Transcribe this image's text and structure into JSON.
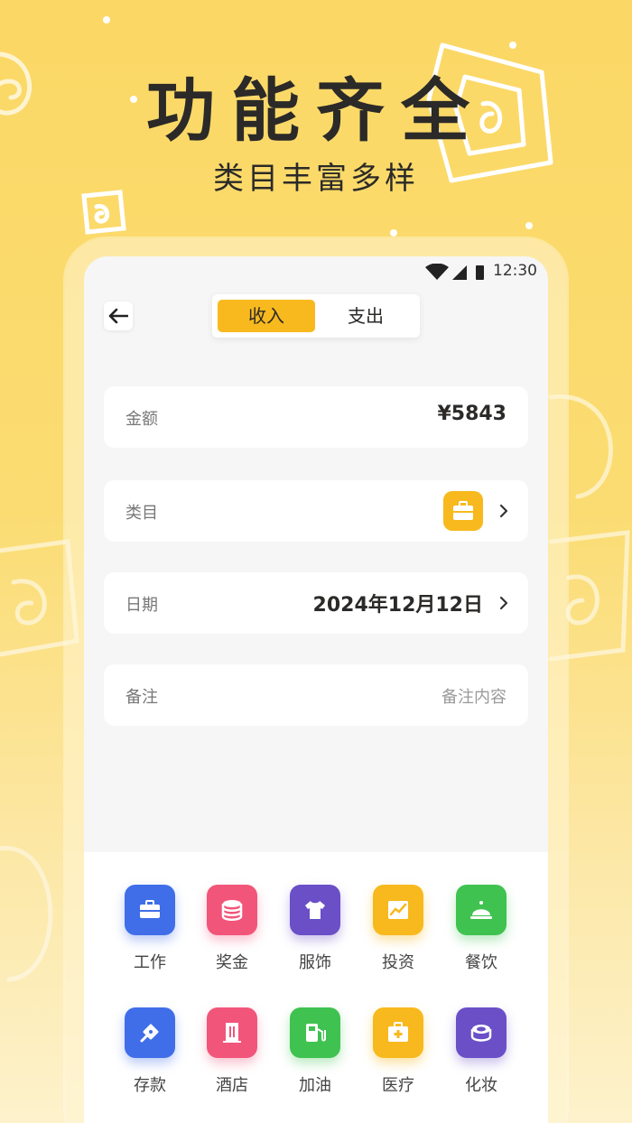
{
  "promo": {
    "headline": "功能齐全",
    "subline": "类目丰富多样"
  },
  "status_bar": {
    "time": "12:30",
    "icons": [
      "wifi-icon",
      "signal-icon",
      "battery-icon"
    ]
  },
  "toolbar": {
    "back_icon": "arrow-left-icon",
    "tabs": [
      {
        "label": "收入",
        "active": true
      },
      {
        "label": "支出",
        "active": false
      }
    ]
  },
  "form": {
    "amount": {
      "label": "金额",
      "value": "¥5843"
    },
    "category": {
      "label": "类目",
      "icon": "briefcase-icon"
    },
    "date": {
      "label": "日期",
      "value": "2024年12月12日"
    },
    "note": {
      "label": "备注",
      "placeholder": "备注内容"
    }
  },
  "categories": [
    {
      "label": "工作",
      "icon": "briefcase-icon",
      "color": "#3f6ee8"
    },
    {
      "label": "奖金",
      "icon": "coin-stack-icon",
      "color": "#f2557a"
    },
    {
      "label": "服饰",
      "icon": "tshirt-icon",
      "color": "#6a4fc7"
    },
    {
      "label": "投资",
      "icon": "trend-chart-icon",
      "color": "#f8b91e"
    },
    {
      "label": "餐饮",
      "icon": "food-cloche-icon",
      "color": "#3fc250"
    },
    {
      "label": "存款",
      "icon": "piggy-hand-icon",
      "color": "#3f6ee8"
    },
    {
      "label": "酒店",
      "icon": "building-icon",
      "color": "#f2557a"
    },
    {
      "label": "加油",
      "icon": "fuel-pump-icon",
      "color": "#3fc250"
    },
    {
      "label": "医疗",
      "icon": "medical-kit-icon",
      "color": "#f8b91e"
    },
    {
      "label": "化妆",
      "icon": "cosmetic-icon",
      "color": "#6a4fc7"
    }
  ],
  "colors": {
    "accent": "#f8b91e",
    "background": "#fbd865"
  }
}
